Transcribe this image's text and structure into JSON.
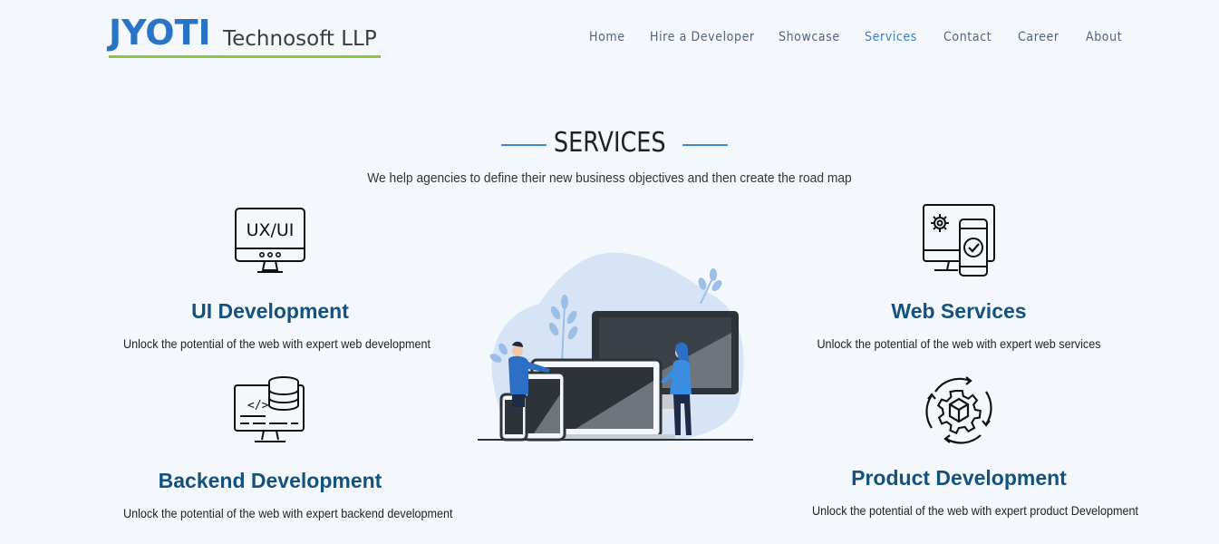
{
  "brand": {
    "name_primary": "JYOTI",
    "name_secondary": "Technosoft LLP"
  },
  "nav": {
    "items": [
      {
        "label": "Home"
      },
      {
        "label": "Hire a Developer"
      },
      {
        "label": "Showcase"
      },
      {
        "label": "Services",
        "active": true
      },
      {
        "label": "Contact"
      },
      {
        "label": "Career"
      },
      {
        "label": "About"
      }
    ]
  },
  "section": {
    "title": "SERVICES",
    "subtitle": "We help agencies to define their new business objectives and then create the road map"
  },
  "services": {
    "ui": {
      "icon": "ux-ui-monitor-icon",
      "title": "UI Development",
      "desc": "Unlock the potential of the web with expert web development"
    },
    "web": {
      "icon": "web-services-devices-icon",
      "title": "Web Services",
      "desc": "Unlock the potential of the web with expert web services"
    },
    "backend": {
      "icon": "database-code-monitor-icon",
      "title": "Backend Development",
      "desc": "Unlock the potential of the web with expert backend development"
    },
    "product": {
      "icon": "gear-cube-cycle-icon",
      "title": "Product Development",
      "desc": "Unlock the potential of the web with expert product Development"
    }
  },
  "colors": {
    "brand_blue": "#2a74c8",
    "brand_green": "#8cc63f",
    "heading_blue": "#14527e",
    "nav_active": "#3b7fc4",
    "background": "#f4f7fb"
  }
}
